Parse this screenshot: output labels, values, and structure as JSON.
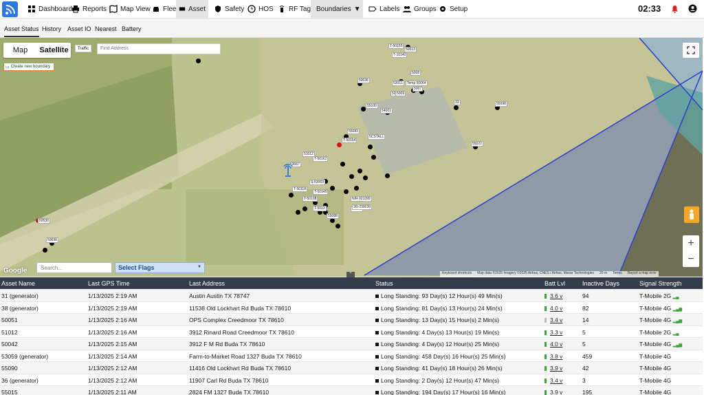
{
  "nav": {
    "items": [
      "Dashboard",
      "Reports",
      "Map View",
      "Fleet",
      "Asset",
      "Safety",
      "HOS",
      "RF Tags",
      "Boundaries",
      "Labels",
      "Groups",
      "Setup"
    ],
    "clock": "02:33"
  },
  "subnav": {
    "items": [
      "Asset Status",
      "History",
      "Asset IO",
      "Nearest",
      "Battery"
    ]
  },
  "map": {
    "map_label": "Map",
    "satellite_label": "Satellite",
    "traffic_label": "Traffic",
    "find_placeholder": "Find Address",
    "create_boundary": "Create new boundary",
    "google": "Google",
    "footer": [
      "Keyboard shortcuts",
      "Map data ©2025 Imagery ©2025 Airbus, CNES / Airbus, Maxar Technologies",
      "20 m",
      "Terms",
      "Report a map error"
    ],
    "labels": [
      "T-50155",
      "50513",
      "T-10140",
      "50036",
      "5008",
      "53011",
      "Temp 50064",
      "5007",
      "5006",
      "5009",
      "33",
      "55100",
      "55098",
      "54001",
      "55083",
      "5CSTALL",
      "T-50154",
      "55022",
      "51012",
      "T-50162",
      "53067",
      "S-53069",
      "T-50118",
      "T-50145",
      "T-50108",
      "N/R 021099",
      "T-5013",
      "55088",
      "53041",
      "3G-239039",
      "50530",
      "50698"
    ]
  },
  "search": {
    "placeholder": "Search...",
    "flags": "Select Flags"
  },
  "table": {
    "headers": [
      "Asset Name",
      "Last GPS Time",
      "Last Address",
      "Status",
      "Batt Lvl",
      "Inactive Days",
      "Signal Strength"
    ],
    "rows": [
      [
        "31 (generator)",
        "1/13/2025 2:19 AM",
        "Austin Austin TX 78747",
        "Long Standing: 93 Day(s) 12 Hour(s) 49 Min(s)",
        "3.6 v",
        "94",
        "T-Mobile 2G"
      ],
      [
        "38 (generator)",
        "1/13/2025 2:19 AM",
        "11538 Old Lockhart Rd Buda TX 78610",
        "Long Standing: 81 Day(s) 13 Hour(s) 24 Min(s)",
        "4.0 v",
        "82",
        "T-Mobile 4G"
      ],
      [
        "50051",
        "1/13/2025 2:16 AM",
        "OPS Complex Creedmoor TX 78610",
        "Long Standing: 13 Day(s) 15 Hour(s) 2 Min(s)",
        "3.4 v",
        "14",
        "T-Mobile 4G"
      ],
      [
        "51012",
        "1/13/2025 2:16 AM",
        "3912 Rinard Road Creedmoor TX 78610",
        "Long Standing: 4 Day(s) 13 Hour(s) 19 Min(s)",
        "3.3 v",
        "5",
        "T-Mobile 2G"
      ],
      [
        "50042",
        "1/13/2025 2:15 AM",
        "3912 F M Rd Buda TX 78610",
        "Long Standing: 4 Day(s) 12 Hour(s) 25 Min(s)",
        "4.0 v",
        "5",
        "T-Mobile 4G"
      ],
      [
        "53059 (generator)",
        "1/13/2025 2:14 AM",
        "Farm-to-Market Road 1327 Buda TX 78610",
        "Long Standing: 458 Day(s) 16 Hour(s) 25 Min(s)",
        "3.8 v",
        "459",
        "T-Mobile 4G"
      ],
      [
        "55090",
        "1/13/2025 2:12 AM",
        "11416 Old Lockhart Rd Buda TX 78610",
        "Long Standing: 41 Day(s) 18 Hour(s) 26 Min(s)",
        "3.9 v",
        "42",
        "T-Mobile 4G"
      ],
      [
        "36 (generator)",
        "1/13/2025 2:12 AM",
        "11907 Carl Rd Buda TX 78610",
        "Long Standing: 2 Day(s) 12 Hour(s) 47 Min(s)",
        "3.4 v",
        "3",
        "T-Mobile 4G"
      ],
      [
        "55015",
        "1/13/2025 2:11 AM",
        "2824 FM 1327 Buda TX 78610",
        "Long Standing: 194 Day(s) 17 Hour(s) 16 Min(s)",
        "3.9 v",
        "195",
        "T-Mobile 4G"
      ]
    ]
  }
}
